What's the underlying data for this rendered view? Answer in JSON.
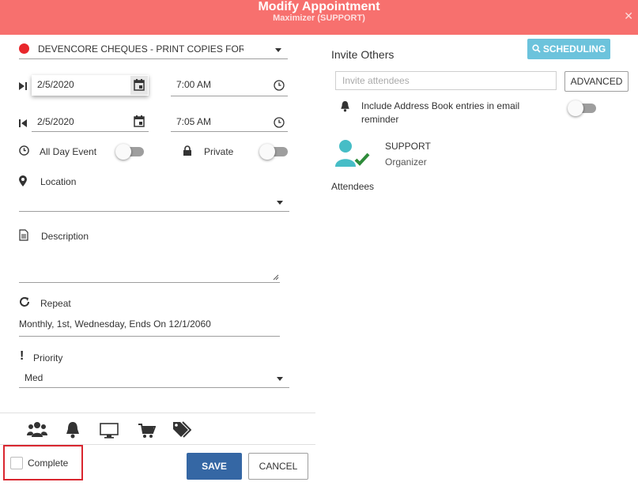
{
  "header": {
    "title": "Modify Appointment",
    "subtitle": "Maximizer (SUPPORT)"
  },
  "form": {
    "subject": "DEVENCORE CHEQUES - PRINT COPIES FOR ...",
    "start_date": "2/5/2020",
    "start_time": "7:00 AM",
    "end_date": "2/5/2020",
    "end_time": "7:05 AM",
    "all_day_label": "All Day Event",
    "private_label": "Private",
    "location_label": "Location",
    "description_label": "Description",
    "repeat_label": "Repeat",
    "repeat_value": "Monthly, 1st, Wednesday, Ends On 12/1/2060",
    "priority_label": "Priority",
    "priority_value": "Med"
  },
  "footer": {
    "complete_label": "Complete",
    "save_label": "SAVE",
    "cancel_label": "CANCEL"
  },
  "invite": {
    "heading": "Invite Others",
    "scheduling_label": "SCHEDULING",
    "placeholder": "Invite attendees",
    "advanced_label": "ADVANCED",
    "address_book_line1": "Include Address Book entries in email",
    "address_book_line2": "reminder",
    "organizer_name": "SUPPORT",
    "organizer_role": "Organizer",
    "attendees_label": "Attendees"
  },
  "colors": {
    "header": "#f7706e",
    "save": "#3567a4",
    "scheduling": "#6cc3dc",
    "status_dot": "#e8262b",
    "organizer_avatar": "#46bdc6",
    "organizer_check": "#2e8b3a"
  },
  "icons": [
    "close-icon",
    "status-dot-icon",
    "dropdown-arrow-icon",
    "start-icon",
    "calendar-icon",
    "clock-icon",
    "end-icon",
    "lock-icon",
    "location-pin-icon",
    "document-icon",
    "repeat-icon",
    "priority-icon",
    "search-icon",
    "bell-icon",
    "person-check-icon",
    "users-icon",
    "monitor-icon",
    "cart-icon",
    "tags-icon"
  ]
}
